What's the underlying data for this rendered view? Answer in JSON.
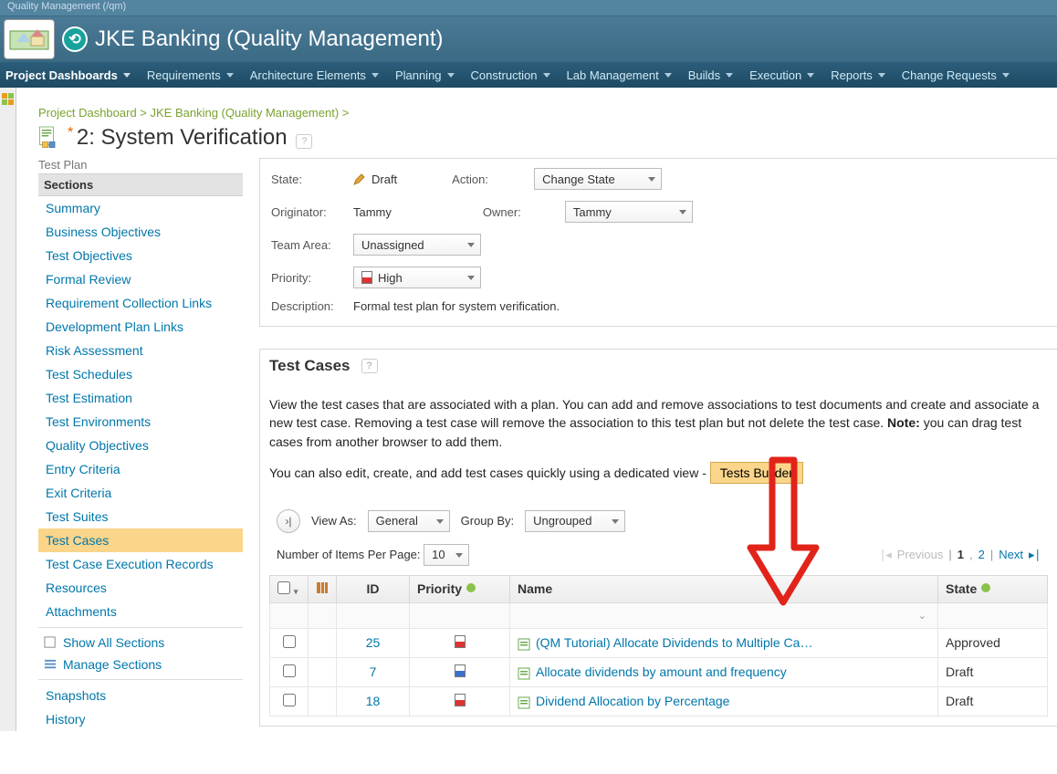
{
  "window": {
    "title": "Quality Management (/qm)"
  },
  "banner": {
    "app_title": "JKE Banking (Quality Management)"
  },
  "nav": {
    "items": [
      "Project Dashboards",
      "Requirements",
      "Architecture Elements",
      "Planning",
      "Construction",
      "Lab Management",
      "Builds",
      "Execution",
      "Reports",
      "Change Requests"
    ]
  },
  "breadcrumb": {
    "a": "Project Dashboard",
    "b": "JKE Banking (Quality Management)"
  },
  "page": {
    "title_prefix": "*",
    "title": "2: System Verification",
    "left_label": "Test Plan"
  },
  "sections": {
    "header": "Sections",
    "items": [
      "Summary",
      "Business Objectives",
      "Test Objectives",
      "Formal Review",
      "Requirement Collection Links",
      "Development Plan Links",
      "Risk Assessment",
      "Test Schedules",
      "Test Estimation",
      "Test Environments",
      "Quality Objectives",
      "Entry Criteria",
      "Exit Criteria",
      "Test Suites",
      "Test Cases",
      "Test Case Execution Records",
      "Resources",
      "Attachments"
    ],
    "selected_index": 14,
    "show_all": "Show All Sections",
    "manage": "Manage Sections",
    "snapshots": "Snapshots",
    "history": "History"
  },
  "info": {
    "state_label": "State:",
    "state_value": "Draft",
    "action_label": "Action:",
    "action_value": "Change State",
    "originator_label": "Originator:",
    "originator_value": "Tammy",
    "owner_label": "Owner:",
    "owner_value": "Tammy",
    "team_label": "Team Area:",
    "team_value": "Unassigned",
    "priority_label": "Priority:",
    "priority_value": "High",
    "description_label": "Description:",
    "description_value": "Formal test plan for system verification."
  },
  "testcases": {
    "heading": "Test Cases",
    "para1": "View the test cases that are associated with a plan. You can add and remove associations to test documents and create and associate a new test case. Removing a test case will remove the association to this test plan but not delete the test case. ",
    "note_label": "Note:",
    "note_text": " you can drag test cases from another browser to add them.",
    "para2_prefix": "You can also edit, create, and add test cases quickly using a dedicated view - ",
    "builder_btn": "Tests Builder",
    "view_as_label": "View As:",
    "view_as_value": "General",
    "group_by_label": "Group By:",
    "group_by_value": "Ungrouped",
    "items_per_page_label": "Number of Items Per Page:",
    "items_per_page_value": "10",
    "pager_previous": "Previous",
    "pager_next": "Next",
    "pager_p1": "1",
    "pager_p2": "2",
    "columns": {
      "id": "ID",
      "priority": "Priority",
      "name": "Name",
      "state": "State"
    },
    "rows": [
      {
        "id": "25",
        "name": "(QM Tutorial) Allocate Dividends to Multiple Ca…",
        "state": "Approved",
        "prio_color": "#d33"
      },
      {
        "id": "7",
        "name": "Allocate dividends by amount and frequency",
        "state": "Draft",
        "prio_color": "#3b6fd1"
      },
      {
        "id": "18",
        "name": "Dividend Allocation by Percentage",
        "state": "Draft",
        "prio_color": "#d33"
      }
    ]
  }
}
